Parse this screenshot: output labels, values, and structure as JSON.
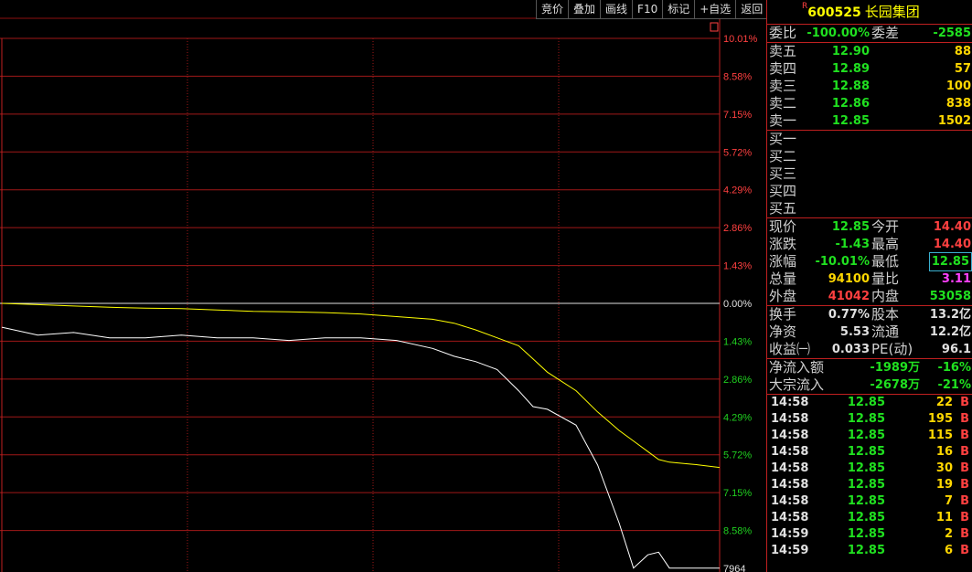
{
  "toolbar": [
    "竞价",
    "叠加",
    "画线",
    "F10",
    "标记",
    "+自选",
    "返回"
  ],
  "stock": {
    "marker": "R",
    "code": "600525",
    "name": "长园集团"
  },
  "weibi": {
    "label1": "委比",
    "value1": "-100.00%",
    "label2": "委差",
    "value2": "-2585"
  },
  "sell_orders": [
    {
      "label": "卖五",
      "price": "12.90",
      "vol": "88"
    },
    {
      "label": "卖四",
      "price": "12.89",
      "vol": "57"
    },
    {
      "label": "卖三",
      "price": "12.88",
      "vol": "100"
    },
    {
      "label": "卖二",
      "price": "12.86",
      "vol": "838"
    },
    {
      "label": "卖一",
      "price": "12.85",
      "vol": "1502"
    }
  ],
  "buy_orders": [
    {
      "label": "买一"
    },
    {
      "label": "买二"
    },
    {
      "label": "买三"
    },
    {
      "label": "买四"
    },
    {
      "label": "买五"
    }
  ],
  "quote": [
    {
      "l1": "现价",
      "v1": "12.85",
      "c1": "g",
      "l2": "今开",
      "v2": "14.40",
      "c2": "r2"
    },
    {
      "l1": "涨跌",
      "v1": "-1.43",
      "c1": "g",
      "l2": "最高",
      "v2": "14.40",
      "c2": "r2"
    },
    {
      "l1": "涨幅",
      "v1": "-10.01%",
      "c1": "g",
      "l2": "最低",
      "v2": "12.85",
      "c2": "g"
    },
    {
      "l1": "总量",
      "v1": "94100",
      "c1": "y",
      "l2": "量比",
      "v2": "3.11",
      "c2": "m"
    },
    {
      "l1": "外盘",
      "v1": "41042",
      "c1": "r2",
      "l2": "内盘",
      "v2": "53058",
      "c2": "g"
    }
  ],
  "stats": [
    {
      "l1": "换手",
      "v1": "0.77%",
      "l2": "股本",
      "v2": "13.2亿"
    },
    {
      "l1": "净资",
      "v1": "5.53",
      "l2": "流通",
      "v2": "12.2亿"
    },
    {
      "l1": "收益㈠",
      "v1": "0.033",
      "l2": "PE(动)",
      "v2": "96.1"
    }
  ],
  "flows": [
    {
      "label": "净流入额",
      "value": "-1989万",
      "pct": "-16%"
    },
    {
      "label": "大宗流入",
      "value": "-2678万",
      "pct": "-21%"
    }
  ],
  "ticks": [
    {
      "time": "14:58",
      "price": "12.85",
      "vol": "22",
      "side": "B"
    },
    {
      "time": "14:58",
      "price": "12.85",
      "vol": "195",
      "side": "B"
    },
    {
      "time": "14:58",
      "price": "12.85",
      "vol": "115",
      "side": "B"
    },
    {
      "time": "14:58",
      "price": "12.85",
      "vol": "16",
      "side": "B"
    },
    {
      "time": "14:58",
      "price": "12.85",
      "vol": "30",
      "side": "B"
    },
    {
      "time": "14:58",
      "price": "12.85",
      "vol": "19",
      "side": "B"
    },
    {
      "time": "14:58",
      "price": "12.85",
      "vol": "7",
      "side": "B"
    },
    {
      "time": "14:58",
      "price": "12.85",
      "vol": "11",
      "side": "B"
    },
    {
      "time": "14:59",
      "price": "12.85",
      "vol": "2",
      "side": "B"
    },
    {
      "time": "14:59",
      "price": "12.85",
      "vol": "6",
      "side": "B"
    }
  ],
  "chart_data": {
    "type": "line",
    "y_axis_right": [
      "10.01%",
      "8.58%",
      "7.15%",
      "5.72%",
      "4.29%",
      "2.86%",
      "1.43%",
      "0.00%",
      "1.43%",
      "2.86%",
      "4.29%",
      "5.72%",
      "7.15%",
      "8.58%"
    ],
    "bottom_label": "7964",
    "ylim_pct": [
      -10.01,
      10.01
    ],
    "x_progress": [
      0,
      0.05,
      0.1,
      0.15,
      0.2,
      0.25,
      0.3,
      0.35,
      0.4,
      0.45,
      0.5,
      0.55,
      0.6,
      0.63,
      0.66,
      0.69,
      0.72,
      0.74,
      0.76,
      0.8,
      0.83,
      0.86,
      0.88,
      0.9,
      0.915,
      0.93,
      0.95,
      0.97,
      1.0
    ],
    "series": [
      {
        "color": "#ffffff",
        "values": [
          -0.9,
          -1.2,
          -1.1,
          -1.3,
          -1.3,
          -1.2,
          -1.3,
          -1.3,
          -1.4,
          -1.3,
          -1.3,
          -1.4,
          -1.7,
          -2.0,
          -2.2,
          -2.5,
          -3.3,
          -3.9,
          -4.0,
          -4.6,
          -6.1,
          -8.3,
          -10.0,
          -9.5,
          -9.4,
          -10.0,
          -10.0,
          -10.0,
          -10.0
        ]
      },
      {
        "color": "#ffff00",
        "values": [
          0.0,
          -0.05,
          -0.1,
          -0.15,
          -0.18,
          -0.2,
          -0.25,
          -0.3,
          -0.32,
          -0.35,
          -0.4,
          -0.5,
          -0.6,
          -0.75,
          -1.0,
          -1.3,
          -1.6,
          -2.1,
          -2.6,
          -3.3,
          -4.1,
          -4.8,
          -5.2,
          -5.6,
          -5.9,
          -6.0,
          -6.05,
          -6.1,
          -6.2
        ]
      }
    ]
  }
}
